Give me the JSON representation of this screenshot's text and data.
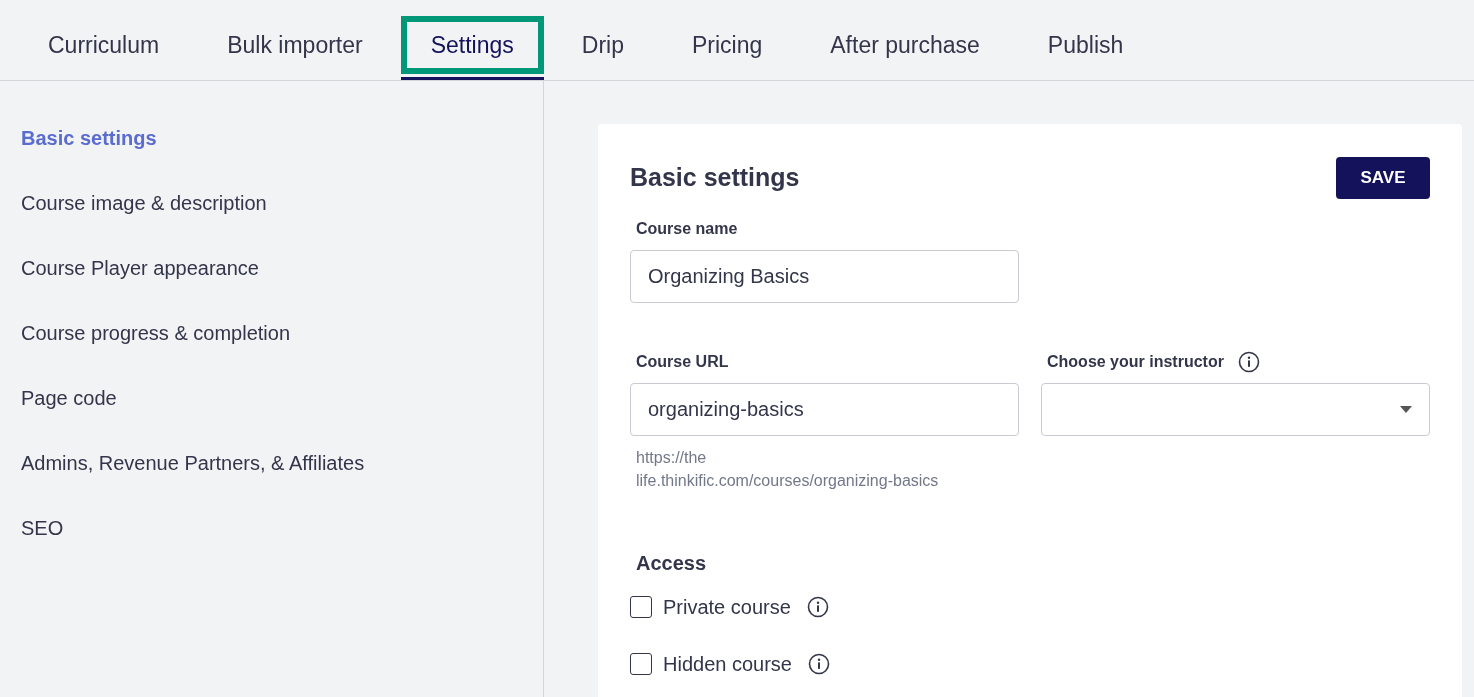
{
  "tabs": [
    {
      "label": "Curriculum",
      "selected": false,
      "highlighted": false
    },
    {
      "label": "Bulk importer",
      "selected": false,
      "highlighted": false
    },
    {
      "label": "Settings",
      "selected": true,
      "highlighted": true
    },
    {
      "label": "Drip",
      "selected": false,
      "highlighted": false
    },
    {
      "label": "Pricing",
      "selected": false,
      "highlighted": false
    },
    {
      "label": "After purchase",
      "selected": false,
      "highlighted": false
    },
    {
      "label": "Publish",
      "selected": false,
      "highlighted": false
    }
  ],
  "sidebar": {
    "items": [
      {
        "label": "Basic settings",
        "selected": true
      },
      {
        "label": "Course image & description",
        "selected": false
      },
      {
        "label": "Course Player appearance",
        "selected": false
      },
      {
        "label": "Course progress & completion",
        "selected": false
      },
      {
        "label": "Page code",
        "selected": false
      },
      {
        "label": "Admins, Revenue Partners, & Affiliates",
        "selected": false
      },
      {
        "label": "SEO",
        "selected": false
      }
    ]
  },
  "panel": {
    "title": "Basic settings",
    "save_button": "SAVE",
    "course_name": {
      "label": "Course name",
      "value": "Organizing Basics"
    },
    "course_url": {
      "label": "Course URL",
      "value": "organizing-basics",
      "hint_lines": [
        "https://the",
        "life.thinkific.com/courses/organizing-basics"
      ]
    },
    "instructor": {
      "label": "Choose your instructor"
    },
    "access": {
      "heading": "Access",
      "options": [
        {
          "label": "Private course",
          "checked": false
        },
        {
          "label": "Hidden course",
          "checked": false
        }
      ]
    }
  }
}
